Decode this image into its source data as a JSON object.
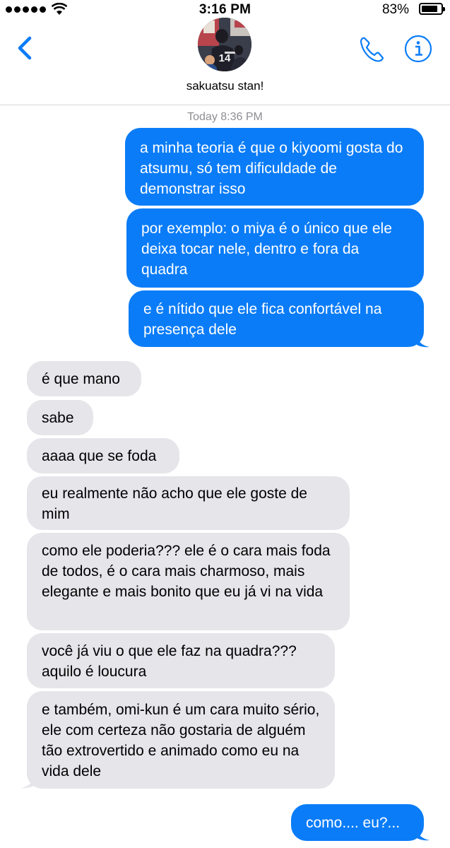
{
  "status_bar": {
    "time": "3:16 PM",
    "battery": "83%",
    "battery_level": 0.83
  },
  "header": {
    "contact_name": "sakuatsu stan!",
    "icons": {
      "back": "chevron-left-icon",
      "phone": "phone-icon",
      "info": "info-icon"
    },
    "accent_color": "#0a7cf8"
  },
  "conversation": {
    "timestamp": "Today 8:36 PM",
    "messages": [
      {
        "from": "me",
        "text": "a minha teoria é que o kiyoomi gosta do atsumu, só tem dificuldade de demonstrar isso"
      },
      {
        "from": "me",
        "text": "por exemplo: o miya é o único que ele deixa tocar nele, dentro e fora da quadra"
      },
      {
        "from": "me",
        "text": "e é nítido que ele fica confortável na presença dele"
      },
      {
        "from": "them",
        "text": "é que mano"
      },
      {
        "from": "them",
        "text": "sabe"
      },
      {
        "from": "them",
        "text": "aaaa que se foda"
      },
      {
        "from": "them",
        "text": "eu realmente não acho que ele goste de mim"
      },
      {
        "from": "them",
        "text": "como ele poderia??? ele é o cara mais foda de todos, é o cara mais charmoso, mais elegante e mais bonito que eu já vi na vida"
      },
      {
        "from": "them",
        "text": "você já viu o que ele faz na quadra??? aquilo é loucura"
      },
      {
        "from": "them",
        "text": "e também, omi-kun é um cara muito sério, ele com certeza não gostaria de alguém tão extrovertido e animado como eu na vida dele"
      },
      {
        "from": "me",
        "text": "como.... eu?..."
      }
    ]
  },
  "colors": {
    "outgoing_bubble": "#0a7cf8",
    "incoming_bubble": "#e5e5ea"
  }
}
